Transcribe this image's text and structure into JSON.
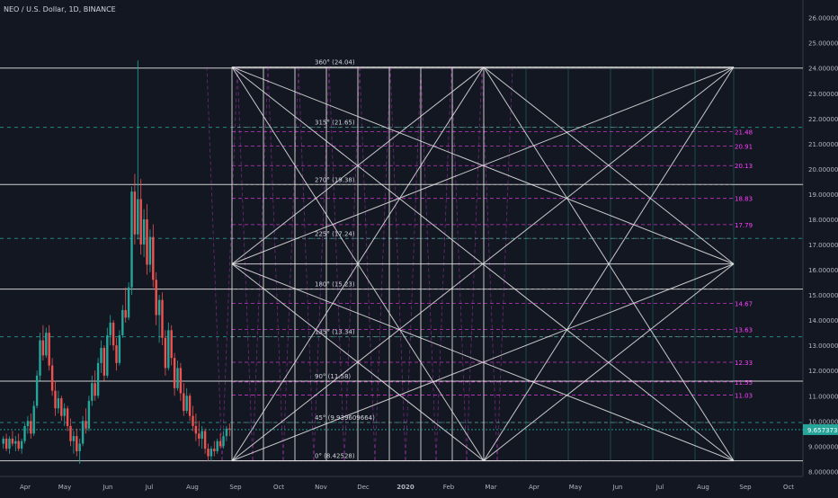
{
  "header": {
    "symbol_title": "NEO / U.S. Dollar, 1D, BINANCE"
  },
  "chart_data": {
    "type": "candlestick",
    "title": "NEO / U.S. Dollar, 1D, BINANCE",
    "ylim": [
      7.8,
      26.7
    ],
    "y_ticks": [
      "26.000000",
      "25.000000",
      "24.000000",
      "23.000000",
      "22.000000",
      "21.000000",
      "20.000000",
      "19.000000",
      "18.000000",
      "17.000000",
      "16.000000",
      "15.000000",
      "14.000000",
      "13.000000",
      "12.000000",
      "11.000000",
      "10.000000",
      "9.000000",
      "8.000000"
    ],
    "x_ticks": [
      "Apr",
      "May",
      "Jun",
      "Jul",
      "Aug",
      "Sep",
      "Oct",
      "Nov",
      "Dec",
      "2020",
      "Feb",
      "Mar",
      "Apr",
      "May",
      "Jun",
      "Jul",
      "Aug",
      "Sep",
      "Oct"
    ],
    "current_price": "9.657373",
    "colors": {
      "up": "#26a69a",
      "down": "#ef5350",
      "fib_line": "#e0e0e0",
      "gann_line": "#ff40ff",
      "current": "#26a69a"
    },
    "horizontal_levels": [
      24.0,
      19.38,
      15.23,
      11.58,
      8.42
    ],
    "teal_levels": [
      21.65,
      17.24,
      13.34,
      9.94
    ],
    "angle_levels": [
      {
        "value": 24.04,
        "label": "360° (24.04)"
      },
      {
        "value": 21.65,
        "label": "315° (21.65)"
      },
      {
        "value": 19.38,
        "label": "270° (19.38)"
      },
      {
        "value": 17.24,
        "label": "225° (17.24)"
      },
      {
        "value": 15.23,
        "label": "180° (15.23)"
      },
      {
        "value": 13.34,
        "label": "135° (13.34)"
      },
      {
        "value": 11.58,
        "label": "90° (11.58)"
      },
      {
        "value": 9.94,
        "label": "45° (9.939609664)"
      },
      {
        "value": 8.42,
        "label": "0° (8.42528)"
      }
    ],
    "magenta_levels": [
      {
        "value": 21.48,
        "label": "21.48"
      },
      {
        "value": 20.91,
        "label": "20.91"
      },
      {
        "value": 20.13,
        "label": "20.13"
      },
      {
        "value": 18.83,
        "label": "18.83"
      },
      {
        "value": 17.79,
        "label": "17.79"
      },
      {
        "value": 14.67,
        "label": "14.67"
      },
      {
        "value": 13.63,
        "label": "13.63"
      },
      {
        "value": 12.33,
        "label": "12.33"
      },
      {
        "value": 11.55,
        "label": "11.55"
      },
      {
        "value": 11.03,
        "label": "11.03"
      }
    ],
    "candles": [
      [
        9.1,
        9.4,
        8.9,
        9.3
      ],
      [
        9.3,
        9.5,
        8.8,
        8.9
      ],
      [
        8.9,
        9.4,
        8.7,
        9.3
      ],
      [
        9.3,
        9.6,
        9.0,
        9.1
      ],
      [
        9.1,
        9.4,
        8.8,
        9.2
      ],
      [
        9.2,
        9.5,
        8.8,
        8.9
      ],
      [
        8.9,
        9.3,
        8.7,
        9.2
      ],
      [
        9.2,
        9.9,
        9.1,
        9.8
      ],
      [
        9.8,
        10.2,
        9.5,
        10.0
      ],
      [
        10.0,
        10.3,
        9.3,
        9.5
      ],
      [
        9.5,
        10.8,
        9.4,
        10.6
      ],
      [
        10.6,
        12.0,
        10.5,
        11.8
      ],
      [
        11.8,
        13.5,
        11.6,
        13.2
      ],
      [
        13.2,
        13.8,
        12.4,
        12.6
      ],
      [
        12.6,
        13.7,
        12.5,
        13.5
      ],
      [
        13.5,
        13.8,
        12.0,
        12.2
      ],
      [
        12.2,
        12.5,
        11.0,
        11.2
      ],
      [
        11.2,
        11.6,
        10.2,
        10.5
      ],
      [
        10.5,
        11.2,
        10.3,
        10.9
      ],
      [
        10.9,
        11.0,
        10.0,
        10.2
      ],
      [
        10.2,
        10.7,
        9.8,
        10.5
      ],
      [
        10.5,
        10.6,
        9.6,
        9.8
      ],
      [
        9.8,
        10.1,
        9.0,
        9.2
      ],
      [
        9.2,
        9.6,
        8.7,
        9.4
      ],
      [
        9.4,
        9.7,
        8.6,
        8.8
      ],
      [
        8.8,
        9.3,
        8.3,
        9.1
      ],
      [
        9.1,
        10.2,
        9.0,
        10.0
      ],
      [
        10.0,
        10.5,
        9.5,
        9.7
      ],
      [
        9.7,
        11.0,
        9.6,
        10.8
      ],
      [
        10.8,
        11.8,
        10.6,
        11.5
      ],
      [
        11.5,
        12.0,
        10.8,
        11.0
      ],
      [
        11.0,
        12.5,
        10.9,
        12.3
      ],
      [
        12.3,
        13.2,
        11.9,
        12.9
      ],
      [
        12.9,
        13.0,
        11.6,
        11.8
      ],
      [
        11.8,
        13.7,
        11.7,
        13.4
      ],
      [
        13.4,
        14.2,
        13.0,
        13.9
      ],
      [
        13.9,
        14.0,
        12.8,
        13.0
      ],
      [
        13.0,
        13.3,
        12.0,
        12.3
      ],
      [
        12.3,
        13.6,
        12.2,
        13.4
      ],
      [
        13.4,
        14.6,
        13.3,
        14.4
      ],
      [
        14.4,
        15.3,
        13.9,
        14.1
      ],
      [
        14.1,
        15.5,
        14.0,
        15.3
      ],
      [
        15.3,
        19.3,
        15.0,
        19.1
      ],
      [
        19.1,
        19.8,
        17.0,
        17.4
      ],
      [
        17.4,
        24.3,
        17.2,
        18.8
      ],
      [
        18.8,
        19.6,
        16.6,
        17.0
      ],
      [
        17.0,
        18.4,
        16.5,
        18.0
      ],
      [
        18.0,
        18.6,
        15.8,
        16.2
      ],
      [
        16.2,
        17.6,
        15.9,
        17.3
      ],
      [
        17.3,
        17.8,
        15.3,
        15.6
      ],
      [
        15.6,
        15.9,
        13.8,
        14.2
      ],
      [
        14.2,
        15.0,
        13.1,
        14.8
      ],
      [
        14.8,
        15.1,
        13.0,
        13.3
      ],
      [
        13.3,
        13.6,
        11.8,
        12.1
      ],
      [
        12.1,
        13.9,
        12.0,
        13.6
      ],
      [
        13.6,
        13.8,
        12.2,
        12.5
      ],
      [
        12.5,
        12.7,
        11.0,
        11.3
      ],
      [
        11.3,
        12.4,
        11.2,
        12.1
      ],
      [
        12.1,
        12.3,
        10.8,
        11.1
      ],
      [
        11.1,
        11.5,
        10.2,
        10.4
      ],
      [
        10.4,
        11.3,
        10.3,
        11.0
      ],
      [
        11.0,
        11.1,
        10.0,
        10.2
      ],
      [
        10.2,
        10.6,
        9.6,
        9.8
      ],
      [
        9.8,
        10.3,
        9.2,
        9.5
      ],
      [
        9.5,
        10.0,
        9.0,
        9.3
      ],
      [
        9.3,
        9.8,
        8.9,
        9.6
      ],
      [
        9.6,
        9.7,
        8.7,
        8.9
      ],
      [
        8.9,
        9.1,
        8.4,
        8.6
      ],
      [
        8.6,
        9.0,
        8.4,
        8.9
      ],
      [
        8.9,
        9.2,
        8.6,
        8.8
      ],
      [
        8.8,
        9.3,
        8.7,
        9.2
      ],
      [
        9.2,
        9.5,
        8.9,
        9.0
      ],
      [
        9.0,
        9.6,
        8.9,
        9.4
      ],
      [
        9.4,
        9.8,
        9.2,
        9.7
      ],
      [
        9.7,
        9.9,
        9.4,
        9.66
      ]
    ]
  }
}
